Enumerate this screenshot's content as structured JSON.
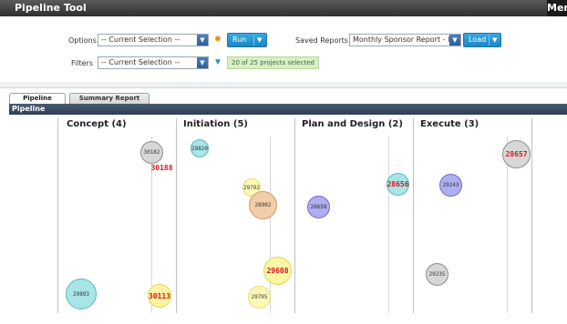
{
  "app": {
    "title": "Pipeline Tool",
    "menu_label": "Men"
  },
  "controls": {
    "options_label": "Options",
    "options_value": "-- Current Selection --",
    "run_label": "Run",
    "saved_reports_label": "Saved Reports",
    "saved_reports_value": "Monthly Sponsor Report - IT",
    "load_label": "Load",
    "filters_label": "Filters",
    "filters_value": "-- Current Selection --",
    "selection_info": "20 of 25 projects selected"
  },
  "tabs": [
    {
      "label": "Pipeline",
      "active": true
    },
    {
      "label": "Summary Report",
      "active": false
    }
  ],
  "section_header": "Pipeline",
  "columns": [
    {
      "label": "Concept (4)"
    },
    {
      "label": "Initiation (5)"
    },
    {
      "label": "Plan and Design (2)"
    },
    {
      "label": "Execute (3)"
    }
  ],
  "bubbles": [
    {
      "id": "30182",
      "color": "grey",
      "highlight": false
    },
    {
      "id": "30188",
      "color": "lightyellow",
      "highlight": true
    },
    {
      "id": "29893",
      "color": "teal",
      "highlight": false
    },
    {
      "id": "30113",
      "color": "yellow",
      "highlight": true
    },
    {
      "id": "28820",
      "color": "teal",
      "highlight": false
    },
    {
      "id": "29792",
      "color": "lightyellow",
      "highlight": false
    },
    {
      "id": "28902",
      "color": "peach",
      "highlight": false
    },
    {
      "id": "29608",
      "color": "yellow",
      "highlight": true
    },
    {
      "id": "29795",
      "color": "lightyellow",
      "highlight": false
    },
    {
      "id": "28658",
      "color": "purple",
      "highlight": false
    },
    {
      "id": "28656",
      "color": "teal",
      "highlight": true
    },
    {
      "id": "28657",
      "color": "grey",
      "highlight": true
    },
    {
      "id": "29243",
      "color": "purple",
      "highlight": false
    },
    {
      "id": "29235",
      "color": "grey",
      "highlight": false
    }
  ]
}
